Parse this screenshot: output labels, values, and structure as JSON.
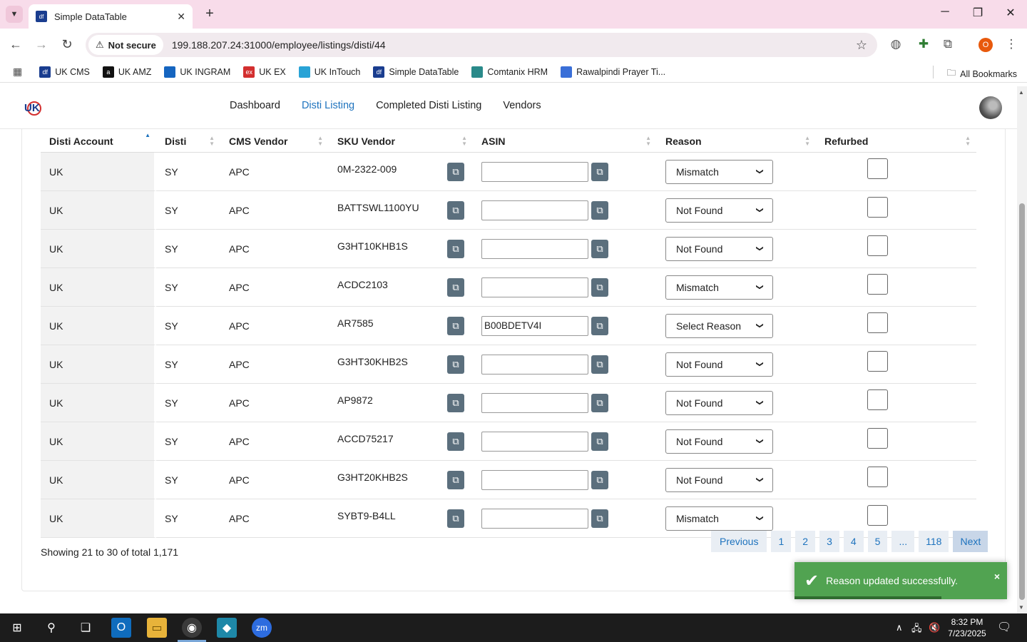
{
  "browser": {
    "tab_title": "Simple DataTable",
    "tab_favicon": "df",
    "security_label": "Not secure",
    "url": "199.188.207.24:31000/employee/listings/disti/44",
    "profile_initial": "O",
    "bookmarks": [
      {
        "label": "UK CMS",
        "icon_text": "df",
        "color": "#1a3d8f"
      },
      {
        "label": "UK AMZ",
        "icon_text": "a",
        "color": "#111111"
      },
      {
        "label": "UK INGRAM",
        "icon_text": "",
        "color": "#1565c0"
      },
      {
        "label": "UK EX",
        "icon_text": "ex",
        "color": "#d32f2f"
      },
      {
        "label": "UK InTouch",
        "icon_text": "",
        "color": "#29a3d6"
      },
      {
        "label": "Simple DataTable",
        "icon_text": "df",
        "color": "#1a3d8f"
      },
      {
        "label": "Comtanix HRM",
        "icon_text": "",
        "color": "#2a8a8a"
      },
      {
        "label": "Rawalpindi Prayer Ti...",
        "icon_text": "",
        "color": "#3a6fd8"
      }
    ],
    "all_bookmarks": "All Bookmarks"
  },
  "app": {
    "logo_text": "UK",
    "nav": [
      {
        "label": "Dashboard",
        "active": false
      },
      {
        "label": "Disti Listing",
        "active": true
      },
      {
        "label": "Completed Disti Listing",
        "active": false
      },
      {
        "label": "Vendors",
        "active": false
      }
    ]
  },
  "table": {
    "columns": [
      "Disti Account",
      "Disti",
      "CMS Vendor",
      "SKU Vendor",
      "ASIN",
      "Reason",
      "Refurbed"
    ],
    "rows": [
      {
        "account": "UK",
        "disti": "SY",
        "cms": "APC",
        "sku": "0M-2322-009",
        "asin": "",
        "reason": "Mismatch"
      },
      {
        "account": "UK",
        "disti": "SY",
        "cms": "APC",
        "sku": "BATTSWL1100YU",
        "asin": "",
        "reason": "Not Found"
      },
      {
        "account": "UK",
        "disti": "SY",
        "cms": "APC",
        "sku": "G3HT10KHB1S",
        "asin": "",
        "reason": "Not Found"
      },
      {
        "account": "UK",
        "disti": "SY",
        "cms": "APC",
        "sku": "ACDC2103",
        "asin": "",
        "reason": "Mismatch"
      },
      {
        "account": "UK",
        "disti": "SY",
        "cms": "APC",
        "sku": "AR7585",
        "asin": "B00BDETV4I",
        "reason": "Select Reason"
      },
      {
        "account": "UK",
        "disti": "SY",
        "cms": "APC",
        "sku": "G3HT30KHB2S",
        "asin": "",
        "reason": "Not Found"
      },
      {
        "account": "UK",
        "disti": "SY",
        "cms": "APC",
        "sku": "AP9872",
        "asin": "",
        "reason": "Not Found"
      },
      {
        "account": "UK",
        "disti": "SY",
        "cms": "APC",
        "sku": "ACCD75217",
        "asin": "",
        "reason": "Not Found"
      },
      {
        "account": "UK",
        "disti": "SY",
        "cms": "APC",
        "sku": "G3HT20KHB2S",
        "asin": "",
        "reason": "Not Found"
      },
      {
        "account": "UK",
        "disti": "SY",
        "cms": "APC",
        "sku": "SYBT9-B4LL",
        "asin": "",
        "reason": "Mismatch"
      }
    ],
    "showing": "Showing 21 to 30 of total 1,171"
  },
  "pagination": {
    "previous": "Previous",
    "pages": [
      "1",
      "2",
      "3",
      "4",
      "5",
      "...",
      "118"
    ],
    "next": "Next"
  },
  "toast": {
    "message": "Reason updated successfully.",
    "close": "×",
    "color": "#51a351"
  },
  "taskbar": {
    "time": "8:32 PM",
    "date": "7/23/2025"
  }
}
